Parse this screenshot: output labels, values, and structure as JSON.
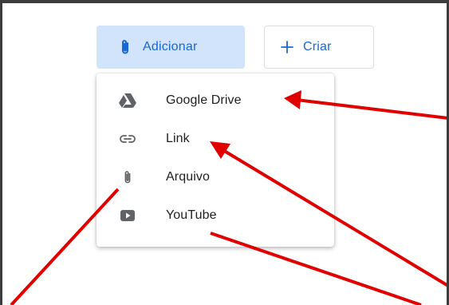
{
  "toolbar": {
    "add_label": "Adicionar",
    "create_label": "Criar"
  },
  "menu": {
    "items": [
      {
        "label": "Google Drive",
        "icon": "google-drive-icon"
      },
      {
        "label": "Link",
        "icon": "link-icon"
      },
      {
        "label": "Arquivo",
        "icon": "paperclip-icon"
      },
      {
        "label": "YouTube",
        "icon": "youtube-icon"
      }
    ]
  },
  "colors": {
    "accent": "#1967d2",
    "add_button_bg": "#d2e3fc",
    "menu_icon": "#5f6368",
    "annotation_arrow": "#e00000"
  }
}
